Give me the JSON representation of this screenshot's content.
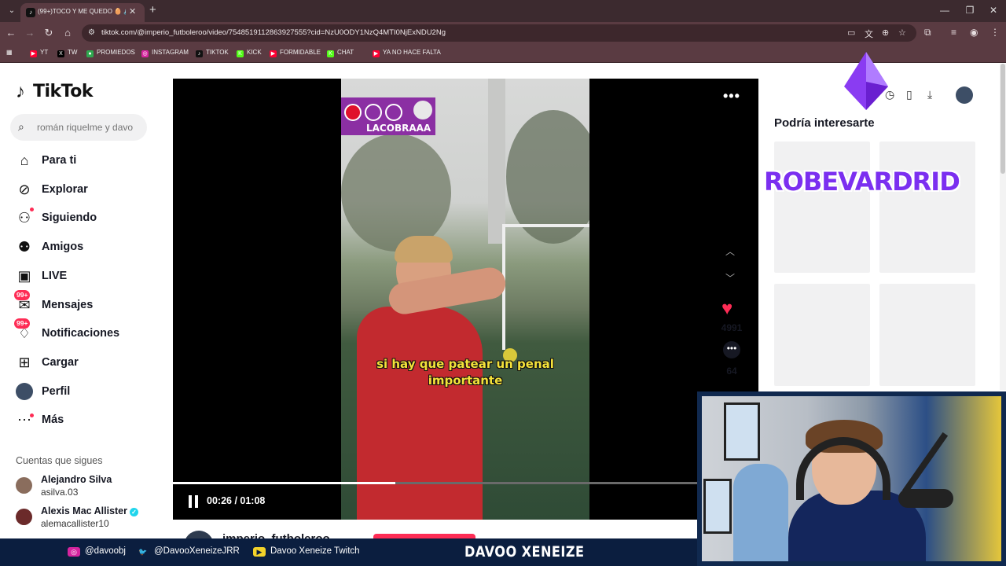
{
  "browser": {
    "tab_title": "(99+)TOCO Y ME QUEDO 🥚 🔊",
    "url": "tiktok.com/@imperio_futboleroo/video/7548519112863927555?cid=NzU0ODY1NzQ4MTI0NjExNDU2Ng",
    "bookmarks": [
      {
        "label": "YT",
        "icon": "youtube-icon",
        "color": "#ff0033"
      },
      {
        "label": "TW",
        "icon": "x-icon",
        "color": "#000000"
      },
      {
        "label": "PROMIEDOS",
        "icon": "promiedos-icon",
        "color": "#2fa84f"
      },
      {
        "label": "INSTAGRAM",
        "icon": "instagram-icon",
        "color": "#d6249f"
      },
      {
        "label": "TIKTOK",
        "icon": "tiktok-icon",
        "color": "#111111"
      },
      {
        "label": "KICK",
        "icon": "kick-icon",
        "color": "#53fc18"
      },
      {
        "label": "FORMIDABLE",
        "icon": "youtube-icon",
        "color": "#ff0033"
      },
      {
        "label": "CHAT",
        "icon": "kick-icon",
        "color": "#53fc18"
      },
      {
        "label": "YA NO HACE FALTA",
        "icon": "youtube-icon",
        "color": "#ff0033"
      }
    ]
  },
  "tiktok": {
    "logo": "TikTok",
    "search_placeholder": "román riquelme y davo",
    "nav": [
      {
        "label": "Para ti",
        "icon": "home-icon"
      },
      {
        "label": "Explorar",
        "icon": "compass-icon"
      },
      {
        "label": "Siguiendo",
        "icon": "following-icon"
      },
      {
        "label": "Amigos",
        "icon": "friends-icon"
      },
      {
        "label": "LIVE",
        "icon": "live-icon"
      },
      {
        "label": "Mensajes",
        "icon": "messages-icon",
        "badge": "99+"
      },
      {
        "label": "Notificaciones",
        "icon": "bell-icon",
        "badge": "99+"
      },
      {
        "label": "Cargar",
        "icon": "upload-icon"
      },
      {
        "label": "Perfil",
        "icon": "profile-avatar"
      },
      {
        "label": "Más",
        "icon": "more-icon"
      }
    ],
    "following_title": "Cuentas que sigues",
    "following": [
      {
        "name": "Alejandro Silva",
        "handle": "asilva.03",
        "verified": false
      },
      {
        "name": "Alexis Mac Allister",
        "handle": "alemacallister10",
        "verified": true
      }
    ],
    "video": {
      "overlay_name": "LACOBRAAA",
      "caption_line1": "si hay que patear un penal",
      "caption_line2": "importante",
      "time": "00:26 / 01:08",
      "progress": 0.38,
      "likes": "4991",
      "comments": "64",
      "author": "imperio_futboleroo"
    },
    "right_title": "Podría interesarte"
  },
  "stream": {
    "watermark": "ROBEVARDRID",
    "bottom_bar": [
      {
        "label": "@davoobj",
        "icon": "instagram-icon"
      },
      {
        "label": "@DavooXeneizeJRR",
        "icon": "twitter-icon"
      },
      {
        "label": "Davoo Xeneize Twitch",
        "icon": "youtube-icon"
      }
    ],
    "brand": "DAVOO XENEIZE"
  },
  "colors": {
    "accent": "#fe2c55",
    "chrome": "#5a3b42",
    "stream_bar": "#0b1e3f",
    "watermark": "#7b2ff0"
  }
}
